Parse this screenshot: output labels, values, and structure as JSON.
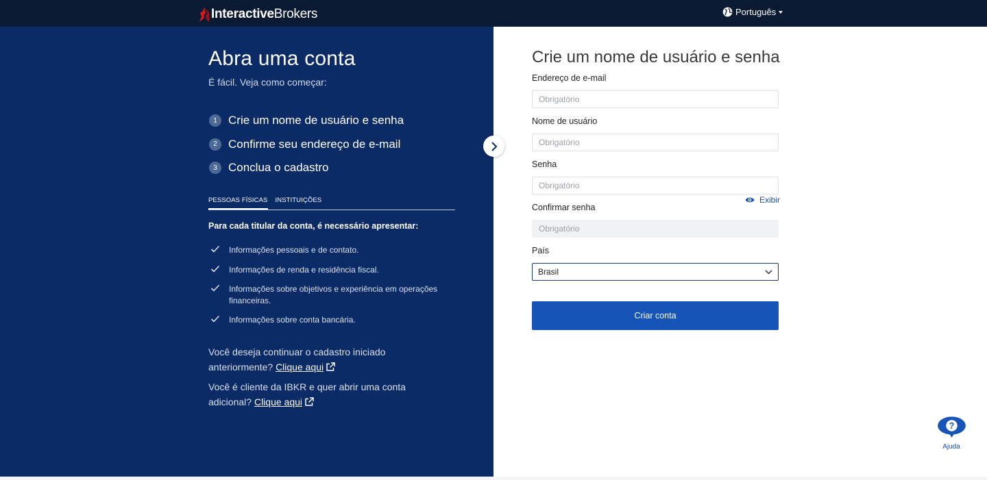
{
  "header": {
    "logo_bold": "Interactive",
    "logo_light": "Brokers",
    "language": "Português",
    "colors": {
      "bar": "#0b1a33",
      "logo_mark": "#d71920"
    }
  },
  "left_panel": {
    "title": "Abra uma conta",
    "subtitle": "É fácil. Veja como começar:",
    "steps": [
      {
        "num": "1",
        "label": "Crie um nome de usuário e senha"
      },
      {
        "num": "2",
        "label": "Confirme seu endereço de e-mail"
      },
      {
        "num": "3",
        "label": "Conclua o cadastro"
      }
    ],
    "tabs": [
      {
        "label": "PESSOAS FÍSICAS",
        "active": true
      },
      {
        "label": "INSTITUIÇÕES",
        "active": false
      }
    ],
    "requirements_title": "Para cada titular da conta, é necessário apresentar:",
    "requirements": [
      "Informações pessoais e de contato.",
      "Informações de renda e residência fiscal.",
      "Informações sobre objetivos e experiência em operações financeiras.",
      "Informações sobre conta bancária."
    ],
    "continue_text": "Você deseja continuar o cadastro iniciado anteriormente?",
    "continue_link": "Clique aqui",
    "additional_text": "Você é cliente da IBKR e quer abrir uma conta adicional?",
    "additional_link": "Clique aqui",
    "colors": {
      "background": "#0b2b66"
    }
  },
  "form": {
    "title": "Crie um nome de usuário e senha",
    "email_label": "Endereço de e-mail",
    "email_placeholder": "Obrigatório",
    "username_label": "Nome de usuário",
    "username_placeholder": "Obrigatório",
    "password_label": "Senha",
    "password_placeholder": "Obrigatório",
    "show_password": "Exibir",
    "confirm_label": "Confirmar senha",
    "confirm_placeholder": "Obrigatório",
    "country_label": "País",
    "country_value": "Brasil",
    "submit_label": "Criar conta",
    "colors": {
      "primary": "#1654b8"
    }
  },
  "help": {
    "label": "Ajuda",
    "icon": "help-question-icon"
  }
}
